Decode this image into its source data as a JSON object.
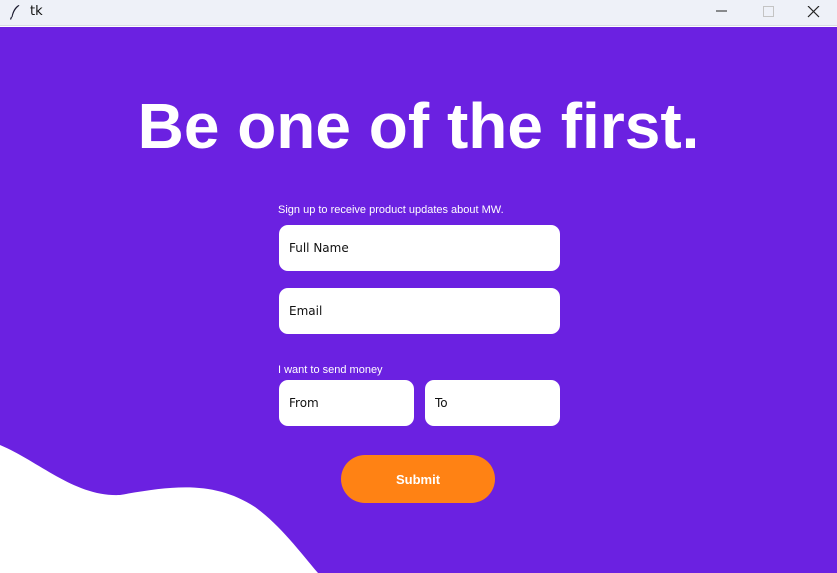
{
  "window": {
    "title": "tk",
    "icon": "feather-icon",
    "controls": [
      "minimize-icon",
      "maximize-icon",
      "close-icon"
    ]
  },
  "colors": {
    "background": "#6b21e1",
    "wave": "#ffffff",
    "submit": "#ff8214",
    "text": "#ffffff"
  },
  "hero": {
    "headline": "Be one of the first."
  },
  "form": {
    "signup_caption": "Sign up to receive product updates about MW.",
    "full_name_placeholder": "Full Name",
    "email_placeholder": "Email",
    "money_caption": "I want to send money",
    "from_placeholder": "From",
    "to_placeholder": "To",
    "submit_label": "Submit"
  }
}
